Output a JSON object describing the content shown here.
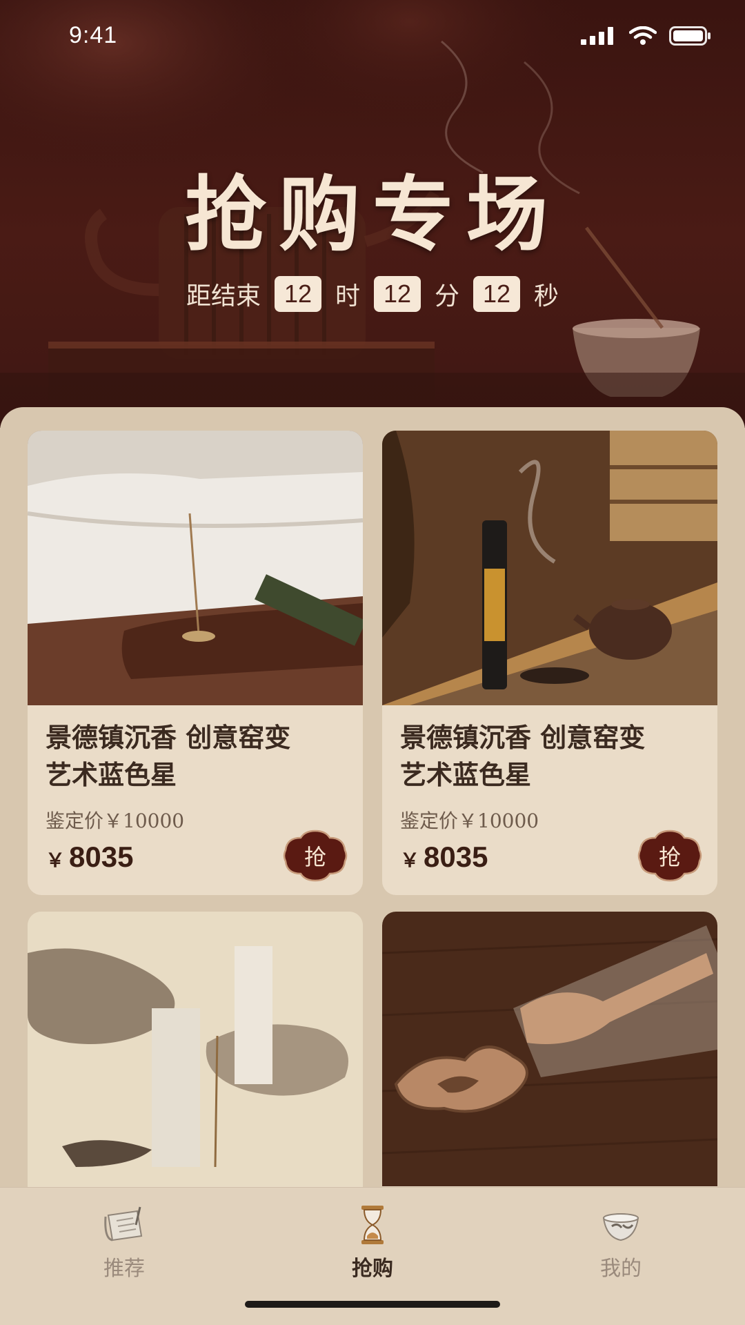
{
  "status_bar": {
    "time": "9:41"
  },
  "hero": {
    "title": "抢购专场",
    "countdown": {
      "prefix": "距结束",
      "hours": "12",
      "hours_unit": "时",
      "minutes": "12",
      "minutes_unit": "分",
      "seconds": "12",
      "seconds_unit": "秒"
    }
  },
  "products": [
    {
      "title_line1": "景德镇沉香 创意窑变",
      "title_line2": "艺术蓝色星",
      "appraised": "鉴定价￥10000",
      "currency": "￥",
      "price": "8035",
      "buy_label": "抢"
    },
    {
      "title_line1": "景德镇沉香 创意窑变",
      "title_line2": "艺术蓝色星",
      "appraised": "鉴定价￥10000",
      "currency": "￥",
      "price": "8035",
      "buy_label": "抢"
    }
  ],
  "tabbar": {
    "tabs": [
      {
        "label": "推荐",
        "icon": "scroll-icon"
      },
      {
        "label": "抢购",
        "icon": "hourglass-icon",
        "active": true
      },
      {
        "label": "我的",
        "icon": "teacup-icon"
      }
    ]
  },
  "colors": {
    "hero_bg": "#3a1410",
    "panel_bg": "#d8c7af",
    "card_bg": "#eadcc8",
    "buy_button": "#5a1a12",
    "title_text": "#f6e6d3"
  }
}
